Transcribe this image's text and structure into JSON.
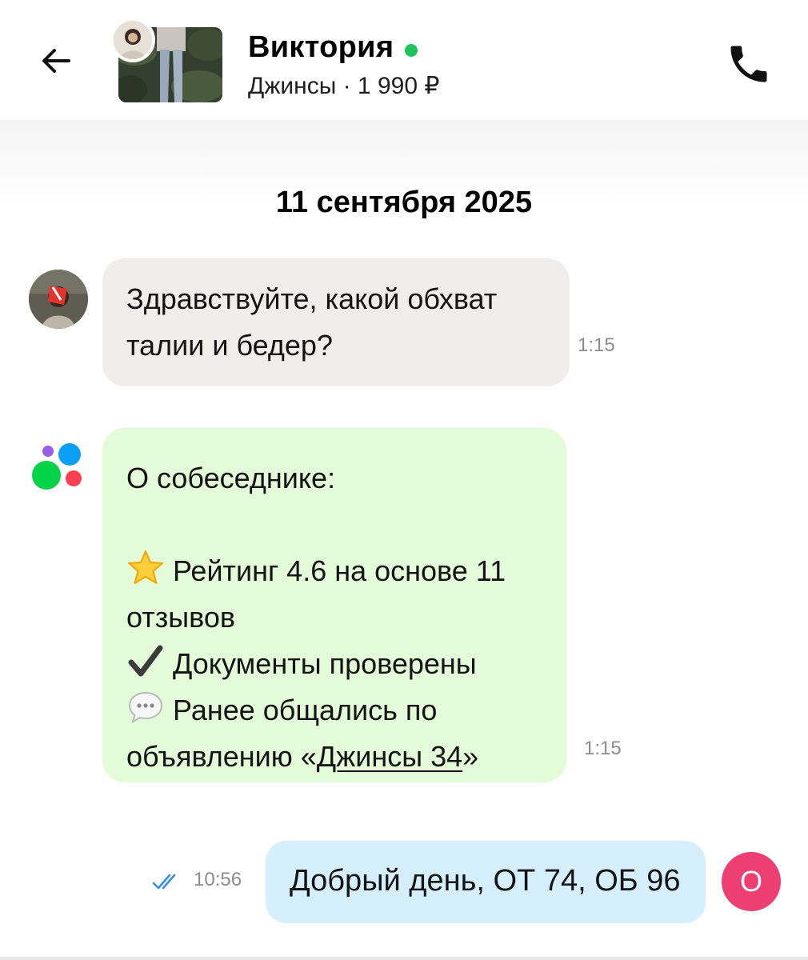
{
  "header": {
    "seller_name": "Виктория",
    "online_color": "#1ec45a",
    "listing_subtitle": "Джинсы · 1 990 ₽",
    "back_icon": "arrow-left-icon",
    "call_icon": "phone-icon"
  },
  "chat": {
    "date_divider": "11 сентября 2025",
    "messages": [
      {
        "type": "incoming",
        "lines": [
          "Здравствуйте, какой обхват",
          "талии и бедер?"
        ],
        "time": "1:15"
      },
      {
        "type": "system",
        "title": "О собеседнике:",
        "rating_line_1": "Рейтинг 4.6 на основе 11",
        "rating_line_2": "отзывов",
        "documents": "Документы проверены",
        "previous_line_1": "Ранее общались по",
        "previous_prefix": "объявлению «",
        "previous_link": "Джинсы 34",
        "previous_suffix": "»",
        "time": "1:15"
      },
      {
        "type": "outgoing",
        "text": "Добрый день, ОТ 74, ОБ 96",
        "time": "10:56",
        "status_icon": "double-check-icon"
      }
    ]
  },
  "own_avatar": {
    "letter": "О",
    "color": "#ee3f72"
  },
  "colors": {
    "incoming_bubble": "#f0eeea",
    "system_bubble": "#e4fbd9",
    "outgoing_bubble": "#d6efff",
    "read_ticks": "#3a8ee6"
  }
}
